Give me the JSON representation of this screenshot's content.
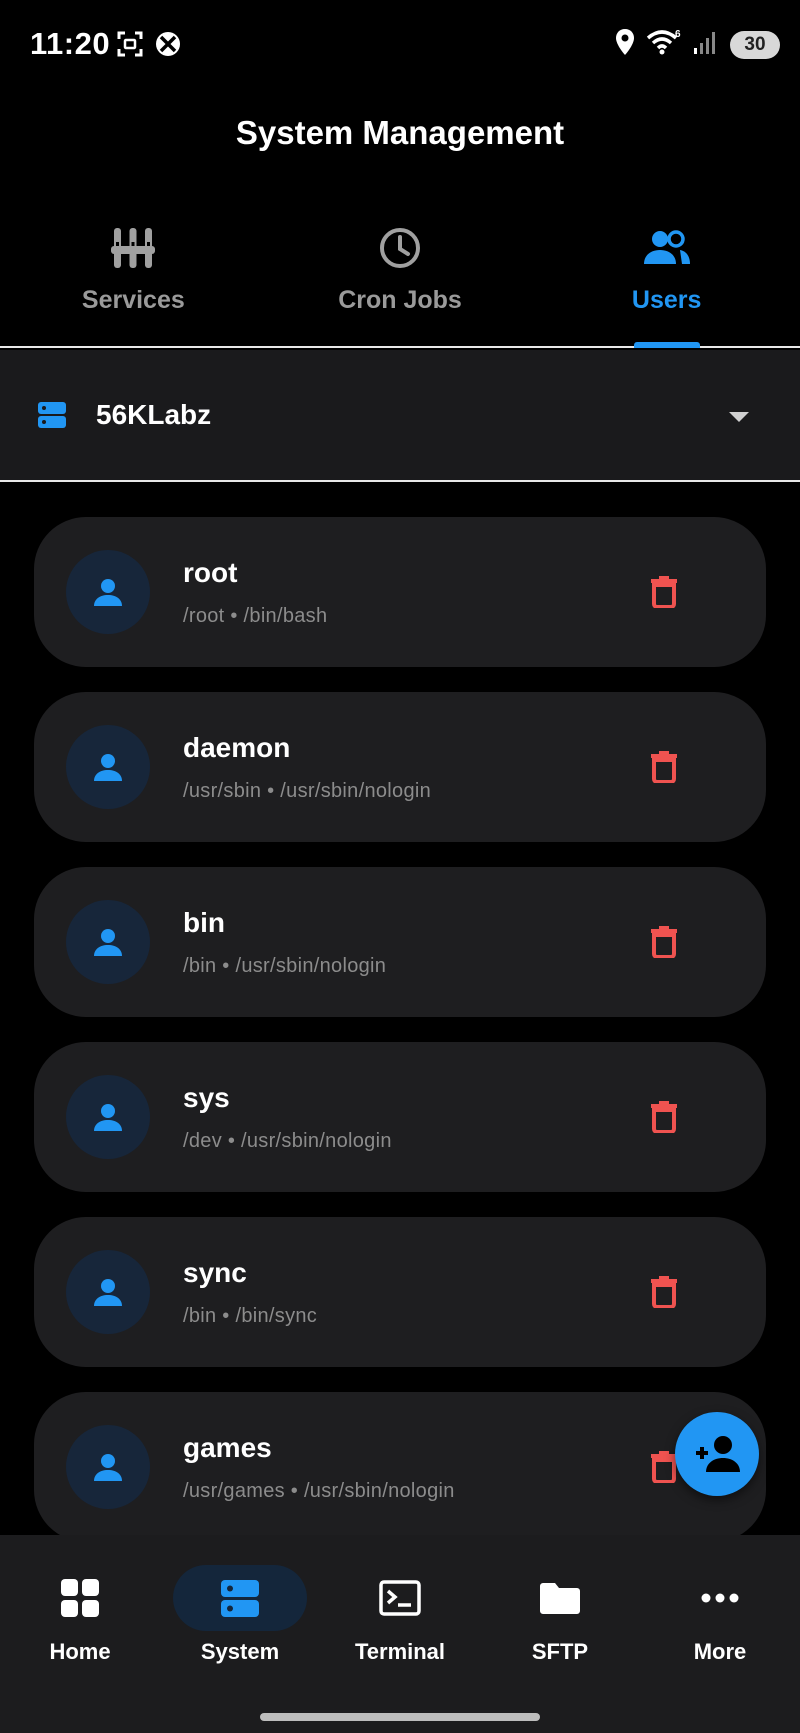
{
  "status_bar": {
    "time": "11:20",
    "battery": "30",
    "icons": [
      "screenshot-icon",
      "xbox-icon",
      "location-icon",
      "wifi-icon",
      "signal-icon"
    ]
  },
  "app": {
    "title": "System Management"
  },
  "tabs": [
    {
      "label": "Services",
      "icon": "services-icon",
      "active": false
    },
    {
      "label": "Cron Jobs",
      "icon": "clock-icon",
      "active": false
    },
    {
      "label": "Users",
      "icon": "users-icon",
      "active": true
    }
  ],
  "server": {
    "name": "56KLabz"
  },
  "users": [
    {
      "name": "root",
      "home": "/root",
      "shell": "/bin/bash"
    },
    {
      "name": "daemon",
      "home": "/usr/sbin",
      "shell": "/usr/sbin/nologin"
    },
    {
      "name": "bin",
      "home": "/bin",
      "shell": "/usr/sbin/nologin"
    },
    {
      "name": "sys",
      "home": "/dev",
      "shell": "/usr/sbin/nologin"
    },
    {
      "name": "sync",
      "home": "/bin",
      "shell": "/bin/sync"
    },
    {
      "name": "games",
      "home": "/usr/games",
      "shell": "/usr/sbin/nologin"
    }
  ],
  "users_meta": [
    "/root • /bin/bash",
    "/usr/sbin • /usr/sbin/nologin",
    "/bin • /usr/sbin/nologin",
    "/dev • /usr/sbin/nologin",
    "/bin • /bin/sync",
    "/usr/games • /usr/sbin/nologin"
  ],
  "fab": {
    "icon": "add-user-icon"
  },
  "bottom_nav": [
    {
      "label": "Home",
      "icon": "grid-icon",
      "active": false
    },
    {
      "label": "System",
      "icon": "server-icon",
      "active": true
    },
    {
      "label": "Terminal",
      "icon": "terminal-icon",
      "active": false
    },
    {
      "label": "SFTP",
      "icon": "folder-icon",
      "active": false
    },
    {
      "label": "More",
      "icon": "more-icon",
      "active": false
    }
  ],
  "colors": {
    "accent": "#2196f3",
    "delete": "#ef5350",
    "background": "#000000",
    "card": "#1e1e20",
    "muted": "#8c8c8c"
  }
}
